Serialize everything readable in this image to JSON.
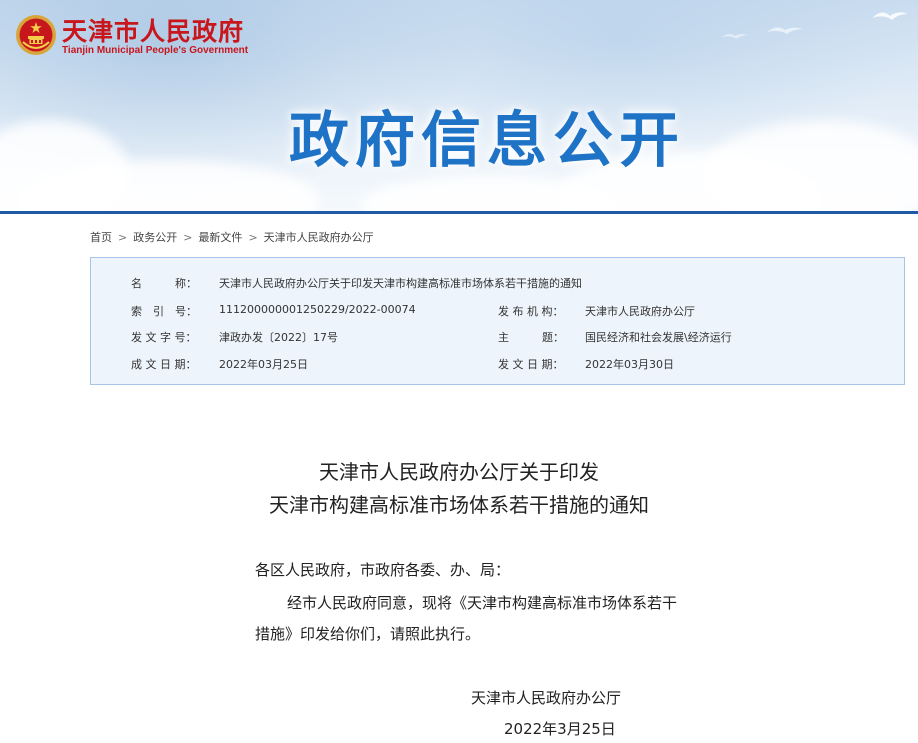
{
  "header": {
    "site_name_cn": "天津市人民政府",
    "site_name_en": "Tianjin Municipal People's Government",
    "banner_title": "政府信息公开",
    "emblem_icon": "national-emblem-icon"
  },
  "breadcrumb": [
    {
      "label": "首页"
    },
    {
      "label": "政务公开"
    },
    {
      "label": "最新文件"
    },
    {
      "label": "天津市人民政府办公厅"
    }
  ],
  "breadcrumb_separator": ">",
  "meta": {
    "name_label": "名　　　称：",
    "name_value": "天津市人民政府办公厅关于印发天津市构建高标准市场体系若干措施的通知",
    "index_label": "索　引　号：",
    "index_value": "111200000001250229/2022-00074",
    "issuer_label": "发 布 机 构：",
    "issuer_value": "天津市人民政府办公厅",
    "docno_label": "发 文 字 号：",
    "docno_value": "津政办发〔2022〕17号",
    "topic_label": "主　　　题：",
    "topic_value": "国民经济和社会发展\\经济运行",
    "created_label": "成 文 日 期：",
    "created_value": "2022年03月25日",
    "published_label": "发 文 日 期：",
    "published_value": "2022年03月30日"
  },
  "article": {
    "title_line1": "天津市人民政府办公厅关于印发",
    "title_line2": "天津市构建高标准市场体系若干措施的通知",
    "salutation": "各区人民政府，市政府各委、办、局：",
    "para1_line1": "经市人民政府同意，现将《天津市构建高标准市场体系若干",
    "para1_line2": "措施》印发给你们，请照此执行。",
    "signature": "天津市人民政府办公厅",
    "date": "2022年3月25日"
  },
  "colors": {
    "brand_red": "#c8161d",
    "banner_title_blue": "#1f73c6",
    "meta_border": "#a7c5e6",
    "meta_bg": "#eef4fb"
  }
}
